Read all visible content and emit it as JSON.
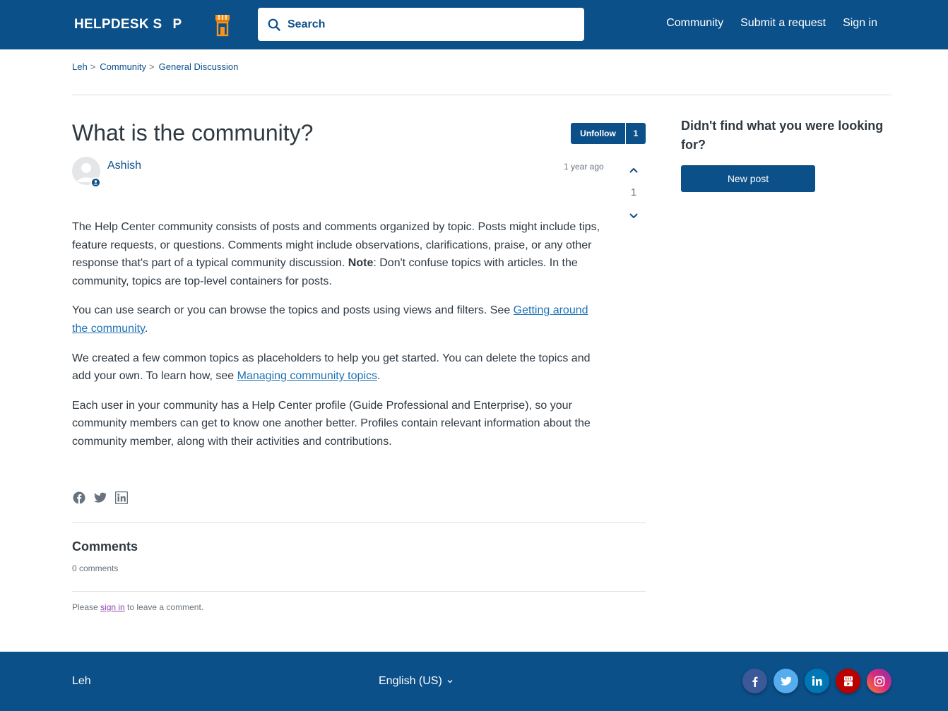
{
  "header": {
    "logo_text_left": "HELPDESK S",
    "logo_text_right": "P",
    "search_placeholder": "Search",
    "nav": [
      "Community",
      "Submit a request",
      "Sign in"
    ]
  },
  "breadcrumb": [
    "Leh",
    "Community",
    "General Discussion"
  ],
  "post": {
    "title": "What is the community?",
    "follow_label": "Unfollow",
    "follow_count": "1",
    "author": "Ashish",
    "time": "1 year ago",
    "vote_count": "1",
    "p1_a": "The Help Center community consists of posts and comments organized by topic. Posts might include tips, feature requests, or questions. Comments might include observations, clarifications, praise, or any other response that's part of a typical community discussion. ",
    "p1_note": "Note",
    "p1_b": ": Don't confuse topics with articles. In the community, topics are top-level containers for posts.",
    "p2_a": "You can use search or you can browse the topics and posts using views and filters. See ",
    "p2_link": "Getting around the community",
    "p2_b": ".",
    "p3_a": "We created a few common topics as placeholders to help you get started. You can delete the topics and add your own. To learn how, see ",
    "p3_link": "Managing community topics",
    "p3_b": ".",
    "p4": "Each user in your community has a Help Center profile (Guide Professional and Enterprise), so your community members can get to know one another better. Profiles contain relevant information about the community member, along with their activities and contributions."
  },
  "share_icons": [
    "facebook-icon",
    "twitter-icon",
    "linkedin-icon"
  ],
  "comments": {
    "title": "Comments",
    "count": "0 comments",
    "note_a": "Please ",
    "note_link": "sign in",
    "note_b": " to leave a comment."
  },
  "sidebar": {
    "title": "Didn't find what you were looking for?",
    "button": "New post"
  },
  "footer": {
    "brand": "Leh",
    "language": "English (US)",
    "socials": [
      {
        "icon": "facebook-icon",
        "color": "#3b5998"
      },
      {
        "icon": "twitter-icon",
        "color": "#55acee"
      },
      {
        "icon": "linkedin-icon",
        "color": "#0077b5"
      },
      {
        "icon": "youtube-icon",
        "color": "#bb0000"
      },
      {
        "icon": "instagram-icon",
        "color": "#c13584"
      }
    ]
  },
  "colors": {
    "brand": "#0c508a",
    "accent": "#f7941d",
    "link": "#1f73b7"
  }
}
